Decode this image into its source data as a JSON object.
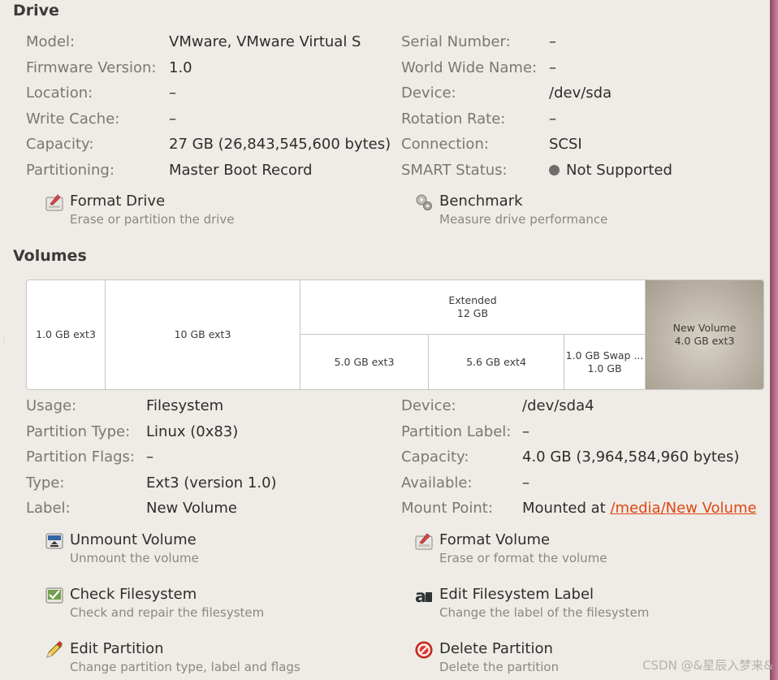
{
  "drive": {
    "title": "Drive",
    "left": [
      {
        "label": "Model:",
        "value": "VMware, VMware Virtual S"
      },
      {
        "label": "Firmware Version:",
        "value": "1.0"
      },
      {
        "label": "Location:",
        "value": "–"
      },
      {
        "label": "Write Cache:",
        "value": "–"
      },
      {
        "label": "Capacity:",
        "value": "27 GB (26,843,545,600 bytes)"
      },
      {
        "label": "Partitioning:",
        "value": "Master Boot Record"
      }
    ],
    "right": [
      {
        "label": "Serial Number:",
        "value": "–"
      },
      {
        "label": "World Wide Name:",
        "value": "–"
      },
      {
        "label": "Device:",
        "value": "/dev/sda"
      },
      {
        "label": "Rotation Rate:",
        "value": "–"
      },
      {
        "label": "Connection:",
        "value": "SCSI"
      },
      {
        "label": "SMART Status:",
        "value": "Not Supported"
      }
    ],
    "actions": {
      "format": {
        "title": "Format Drive",
        "desc": "Erase or partition the drive"
      },
      "benchmark": {
        "title": "Benchmark",
        "desc": "Measure drive performance"
      }
    }
  },
  "volumes": {
    "title": "Volumes",
    "segments": {
      "s1": {
        "line1": "1.0 GB ext3"
      },
      "s2": {
        "line1": "10 GB ext3"
      },
      "extended": {
        "line1": "Extended",
        "line2": "12 GB"
      },
      "s3": {
        "line1": "5.0 GB ext3"
      },
      "s4": {
        "line1": "5.6 GB ext4"
      },
      "s5": {
        "line1": "1.0 GB Swap ...",
        "line2": "1.0 GB"
      },
      "s6": {
        "line1": "New Volume",
        "line2": "4.0 GB ext3"
      }
    },
    "left": [
      {
        "label": "Usage:",
        "value": "Filesystem"
      },
      {
        "label": "Partition Type:",
        "value": "Linux (0x83)"
      },
      {
        "label": "Partition Flags:",
        "value": "–"
      },
      {
        "label": "Type:",
        "value": "Ext3 (version 1.0)"
      },
      {
        "label": "Label:",
        "value": "New Volume"
      }
    ],
    "right": [
      {
        "label": "Device:",
        "value": "/dev/sda4"
      },
      {
        "label": "Partition Label:",
        "value": "–"
      },
      {
        "label": "Capacity:",
        "value": "4.0 GB (3,964,584,960 bytes)"
      },
      {
        "label": "Available:",
        "value": "–"
      },
      {
        "label": "Mount Point:",
        "prefix": "Mounted at ",
        "link": "/media/New Volume"
      }
    ],
    "actions": {
      "unmount": {
        "title": "Unmount Volume",
        "desc": "Unmount the volume"
      },
      "format": {
        "title": "Format Volume",
        "desc": "Erase or format the volume"
      },
      "check": {
        "title": "Check Filesystem",
        "desc": "Check and repair the filesystem"
      },
      "label": {
        "title": "Edit Filesystem Label",
        "desc": "Change the label of the filesystem"
      },
      "edit": {
        "title": "Edit Partition",
        "desc": "Change partition type, label and flags"
      },
      "delete": {
        "title": "Delete Partition",
        "desc": "Delete the partition"
      }
    }
  },
  "watermark": "CSDN @&星辰入梦来&",
  "colors": {
    "background": "#efebe6",
    "link": "#dd4814",
    "selected": "#b9b1a4"
  }
}
